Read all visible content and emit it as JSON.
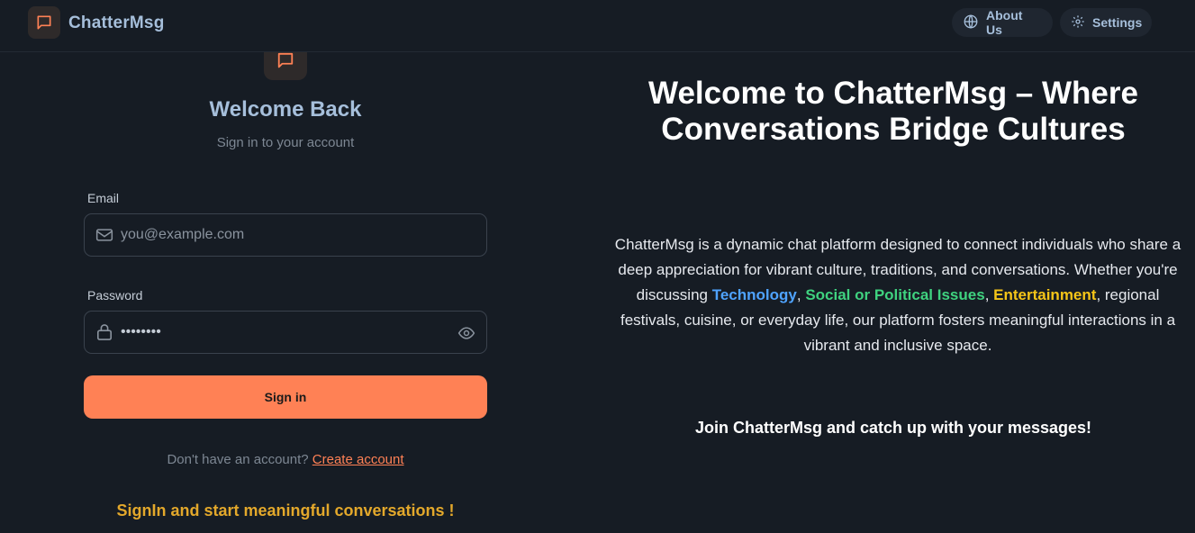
{
  "header": {
    "brand": "ChatterMsg",
    "about_label": "About Us",
    "settings_label": "Settings"
  },
  "login": {
    "title": "Welcome Back",
    "subtitle": "Sign in to your account",
    "email_label": "Email",
    "email_placeholder": "you@example.com",
    "password_label": "Password",
    "password_value": "••••••••",
    "signin_label": "Sign in",
    "no_account_text": "Don't have an account?",
    "create_account_label": "Create account",
    "cta": "SignIn and start meaningful conversations !"
  },
  "hero": {
    "title": "Welcome to ChatterMsg – Where Conversations Bridge Cultures",
    "desc_part1": "ChatterMsg is a dynamic chat platform designed to connect individuals who share a deep appreciation for vibrant culture, traditions, and conversations. Whether you're discussing ",
    "highlight_tech": "Technology",
    "sep1": ", ",
    "highlight_social": "Social or Political Issues",
    "sep2": ", ",
    "highlight_ent": "Entertainment",
    "desc_part2": ", regional festivals, cuisine, or everyday life, our platform fosters meaningful interactions in a vibrant and inclusive space.",
    "join_text": "Join ChatterMsg and catch up with your messages!"
  },
  "colors": {
    "accent": "#ff8155",
    "background": "#161c24",
    "brand_text": "#a6bfdb",
    "cta": "#e3a82b",
    "tech": "#4fa3ff",
    "social": "#3fd27f",
    "entertainment": "#f5c518"
  },
  "icons": {
    "logo": "message-square-icon",
    "about": "globe-icon",
    "settings": "gear-icon",
    "email": "mail-icon",
    "password": "lock-icon",
    "toggle_visibility": "eye-icon"
  }
}
